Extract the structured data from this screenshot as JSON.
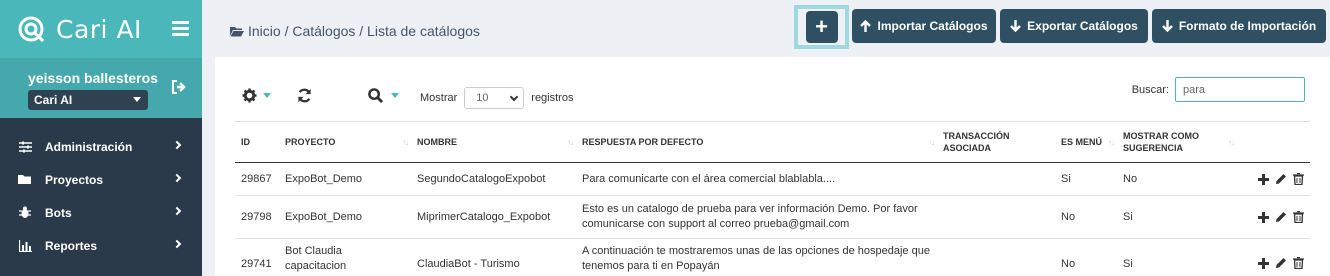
{
  "brand": {
    "name": "Cari AI"
  },
  "user": {
    "name": "yeisson ballesteros",
    "project": "Cari AI"
  },
  "menu": [
    {
      "label": "Administración",
      "icon": "sliders-icon"
    },
    {
      "label": "Proyectos",
      "icon": "folder-icon"
    },
    {
      "label": "Bots",
      "icon": "bug-icon"
    },
    {
      "label": "Reportes",
      "icon": "bar-chart-icon"
    }
  ],
  "breadcrumb": "Inicio / Catálogos / Lista de catálogos",
  "toolbar": {
    "add_label": "+",
    "import_label": "Importar Catálogos",
    "export_label": "Exportar Catálogos",
    "format_label": "Formato de Importación"
  },
  "table_controls": {
    "show_label": "Mostrar",
    "page_size": "10",
    "records_label": "registros",
    "search_label": "Buscar:",
    "search_value": "para"
  },
  "table": {
    "headers": [
      "ID",
      "PROYECTO",
      "NOMBRE",
      "RESPUESTA POR DEFECTO",
      "TRANSACCIÓN ASOCIADA",
      "ES MENÚ",
      "MOSTRAR COMO SUGERENCIA"
    ],
    "rows": [
      {
        "id": "29867",
        "project": "ExpoBot_Demo",
        "name": "SegundoCatalogoExpobot",
        "response": "Para comunicarte con el área comercial blablabla....",
        "transaction": "",
        "is_menu": "Si",
        "suggest": "No"
      },
      {
        "id": "29798",
        "project": "ExpoBot_Demo",
        "name": "MiprimerCatalogo_Expobot",
        "response": "Esto es un catalogo de prueba para ver información Demo. Por favor comunicarse con support al correo prueba@gmail.com",
        "transaction": "",
        "is_menu": "No",
        "suggest": "Si"
      },
      {
        "id": "29741",
        "project": "Bot Claudia capacitacion",
        "name": "ClaudiaBot - Turismo",
        "response": "A continuación te mostraremos unas de las opciones de hospedaje que tenemos para ti en Popayán",
        "transaction": "",
        "is_menu": "No",
        "suggest": "Si"
      }
    ]
  }
}
